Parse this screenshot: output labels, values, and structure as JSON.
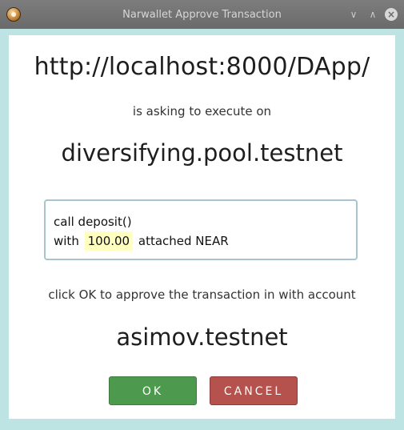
{
  "window": {
    "title": "Narwallet Approve Transaction",
    "minimize_glyph": "∨",
    "maximize_glyph": "∧",
    "close_glyph": "×"
  },
  "dialog": {
    "origin_url": "http://localhost:8000/DApp/",
    "asking_text": "is asking to execute on",
    "contract": "diversifying.pool.testnet",
    "call_line": "call deposit()",
    "with_label": "with",
    "amount": "100.00",
    "attached_label": "attached NEAR",
    "approve_text": "click OK to approve the transaction in with account",
    "account": "asimov.testnet"
  },
  "buttons": {
    "ok_label": "OK",
    "cancel_label": "CANCEL"
  },
  "colors": {
    "ok": "#4d9a4f",
    "cancel": "#b5524e",
    "frame": "#bde3e3",
    "amount_highlight": "#ffffc0"
  }
}
